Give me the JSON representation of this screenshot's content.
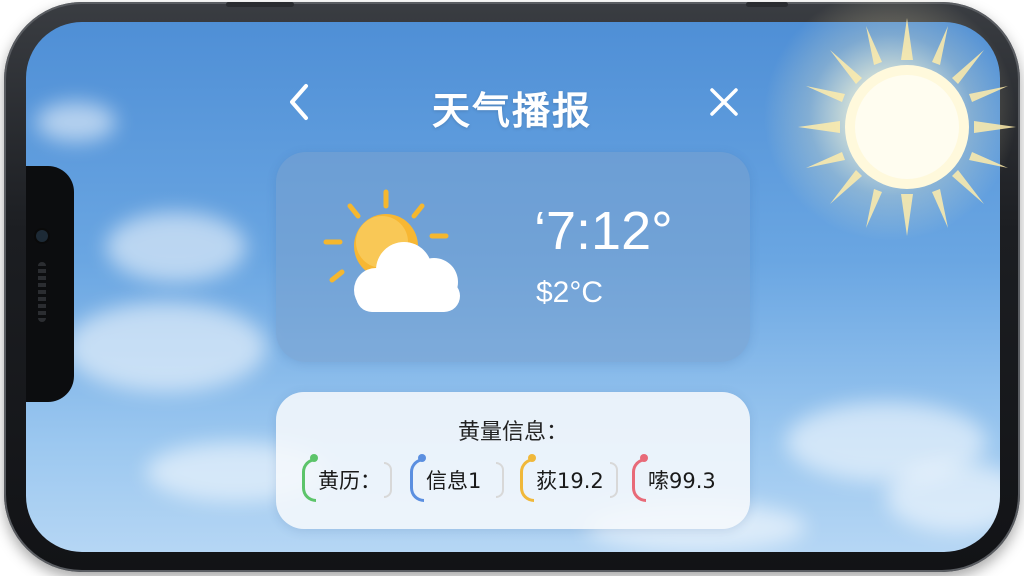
{
  "header": {
    "title": "天气播报",
    "back_icon": "chevron-left-icon",
    "close_icon": "close-icon"
  },
  "weather": {
    "icon": "partly-cloudy-icon",
    "temp_main": "‘7:12°",
    "temp_sub": "$2°C"
  },
  "info": {
    "title": "黄量信息：",
    "chips": [
      {
        "label": "黄历：",
        "color": "#5cc46a"
      },
      {
        "label": "信息1",
        "color": "#5b8fe0"
      },
      {
        "label": "荻19.2",
        "color": "#f0b83a"
      },
      {
        "label": "嗦99.3",
        "color": "#e86a78"
      }
    ]
  },
  "colors": {
    "sky_top": "#4f8fd6",
    "sky_bottom": "#b5d6f4",
    "card_bg": "#7aa3cd",
    "sun": "#f7c948"
  }
}
